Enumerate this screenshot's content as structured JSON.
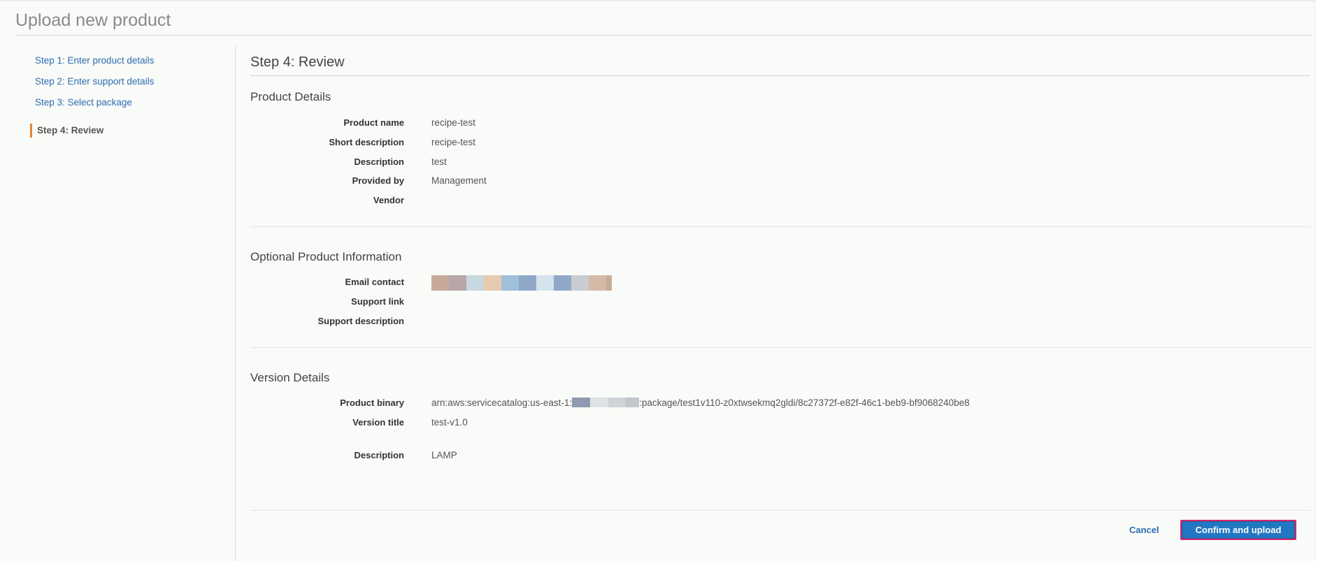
{
  "page": {
    "title": "Upload new product"
  },
  "sidebar": {
    "steps": [
      {
        "label": "Step 1: Enter product details"
      },
      {
        "label": "Step 2: Enter support details"
      },
      {
        "label": "Step 3: Select package"
      },
      {
        "label": "Step 4: Review"
      }
    ],
    "active_step_color": "#e9822c"
  },
  "review": {
    "heading": "Step 4: Review",
    "product_details": {
      "title": "Product Details",
      "rows": [
        {
          "label": "Product name",
          "value": "recipe-test"
        },
        {
          "label": "Short description",
          "value": "recipe-test"
        },
        {
          "label": "Description",
          "value": "test"
        },
        {
          "label": "Provided by",
          "value": "Management"
        },
        {
          "label": "Vendor",
          "value": ""
        }
      ]
    },
    "optional_info": {
      "title": "Optional Product Information",
      "rows": [
        {
          "label": "Email contact",
          "value": ""
        },
        {
          "label": "Support link",
          "value": ""
        },
        {
          "label": "Support description",
          "value": ""
        }
      ]
    },
    "version_details": {
      "title": "Version Details",
      "rows": [
        {
          "label": "Product binary",
          "value_prefix": "arn:aws:servicecatalog:us-east-1:",
          "value_suffix": ":package/test1v110-z0xtwsekmq2gldi/8c27372f-e82f-46c1-beb9-bf9068240be8"
        },
        {
          "label": "Version title",
          "value": "test-v1.0"
        },
        {
          "label": "Description",
          "value": "LAMP"
        }
      ]
    }
  },
  "actions": {
    "cancel_label": "Cancel",
    "confirm_label": "Confirm and upload"
  },
  "colors": {
    "link": "#2e6cb1",
    "primary_button": "#2277c2",
    "highlight_border": "#e0246a"
  }
}
